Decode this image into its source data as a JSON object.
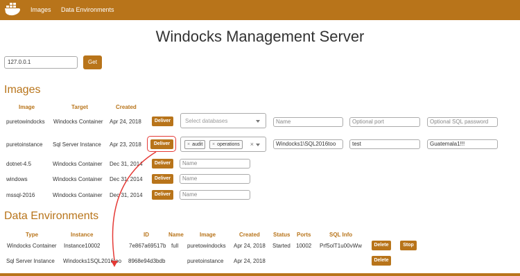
{
  "navbar": {
    "logo": "docker-whale-icon",
    "items": [
      {
        "label": "Images"
      },
      {
        "label": "Data Environments"
      }
    ]
  },
  "page_title": "Windocks Management Server",
  "server": {
    "ip_value": "127.0.0.1",
    "get_label": "Get"
  },
  "images_section": {
    "title": "Images",
    "headers": {
      "image": "Image",
      "target": "Target",
      "created": "Created"
    },
    "deliver_label": "Deliver",
    "rows": [
      {
        "image": "puretowindocks",
        "target": "Windocks Container",
        "created": "Apr 24, 2018",
        "db_placeholder": "Select databases",
        "name_ph": "Name",
        "port_ph": "Optional port",
        "pw_ph": "Optional SQL password"
      },
      {
        "image": "puretoinstance",
        "target": "Sql Server Instance",
        "created": "Apr 23, 2018",
        "db_tags": [
          "audit",
          "operations"
        ],
        "name_value": "Windocks1\\SQL2016too",
        "port_value": "test",
        "pw_value": "Guatemala1!!!"
      },
      {
        "image": "dotnet-4.5",
        "target": "Windocks Container",
        "created": "Dec 31, 2014",
        "name_ph": "Name"
      },
      {
        "image": "windows",
        "target": "Windocks Container",
        "created": "Dec 31, 2014",
        "name_ph": "Name"
      },
      {
        "image": "mssql-2016",
        "target": "Windocks Container",
        "created": "Dec 31, 2014",
        "name_ph": "Name"
      }
    ]
  },
  "data_env_section": {
    "title": "Data Environments",
    "headers": {
      "type": "Type",
      "instance": "Instance",
      "id": "ID",
      "name": "Name",
      "image": "Image",
      "created": "Created",
      "status": "Status",
      "ports": "Ports",
      "sql_info": "SQL Info"
    },
    "delete_label": "Delete",
    "stop_label": "Stop",
    "rows": [
      {
        "type": "Windocks Container",
        "instance": "Instance10002",
        "id": "7e867a69517b",
        "name": "full",
        "image": "puretowindocks",
        "created": "Apr 24, 2018",
        "status": "Started",
        "ports": "10002",
        "sql_info": "Prf5olT1u00vWw"
      },
      {
        "type": "Sql Server Instance",
        "instance": "Windocks1SQL2016too",
        "id": "8968e94d3bdb",
        "name": "",
        "image": "puretoinstance",
        "created": "Apr 24, 2018",
        "status": "",
        "ports": "",
        "sql_info": ""
      }
    ]
  },
  "colors": {
    "accent": "#b8741a",
    "annotation": "#e53935"
  }
}
